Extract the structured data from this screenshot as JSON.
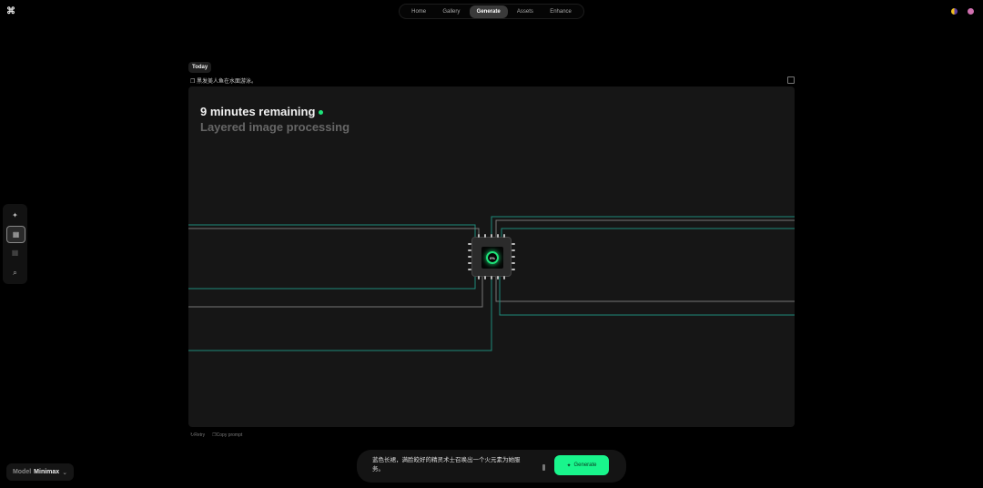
{
  "nav": {
    "items": [
      "Home",
      "Gallery",
      "Generate",
      "Assets",
      "Enhance"
    ],
    "active": "Generate"
  },
  "history": {
    "section": "Today",
    "prompt": "黑发美人鱼在水面游泳。"
  },
  "progress": {
    "title": "9 minutes remaining",
    "subtitle": "Layered image processing",
    "chip_label": "0%"
  },
  "actions": {
    "retry": "Retry",
    "copy": "Copy prompt"
  },
  "model": {
    "label": "Model",
    "value": "Minimax"
  },
  "composer": {
    "text": "蓝色长裙，满脸皎好的精灵术士召唤出一个火元素为她服务。",
    "button": "Generate"
  },
  "colors": {
    "accent": "#19f58c",
    "status_dot": "#1ee37a"
  }
}
